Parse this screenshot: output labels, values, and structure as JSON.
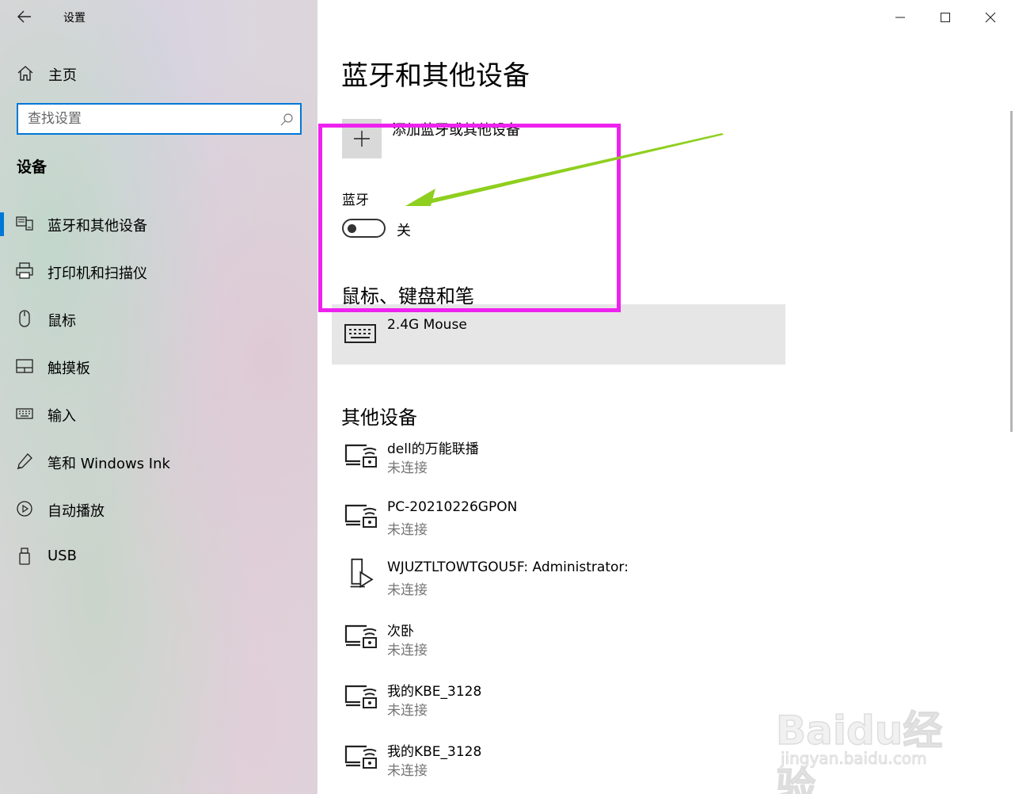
{
  "window": {
    "title": "设置",
    "controls": {
      "minimize": "minimize-icon",
      "maximize": "maximize-icon",
      "close": "close-icon"
    }
  },
  "sidebar": {
    "home_label": "主页",
    "search_placeholder": "查找设置",
    "section_title": "设备",
    "items": [
      {
        "label": "蓝牙和其他设备",
        "icon": "bluetooth-devices-icon",
        "selected": true
      },
      {
        "label": "打印机和扫描仪",
        "icon": "printer-icon"
      },
      {
        "label": "鼠标",
        "icon": "mouse-icon"
      },
      {
        "label": "触摸板",
        "icon": "touchpad-icon"
      },
      {
        "label": "输入",
        "icon": "keyboard-icon"
      },
      {
        "label": "笔和 Windows Ink",
        "icon": "pen-icon"
      },
      {
        "label": "自动播放",
        "icon": "autoplay-icon"
      },
      {
        "label": "USB",
        "icon": "usb-icon"
      }
    ]
  },
  "main": {
    "page_title": "蓝牙和其他设备",
    "add_device_label": "添加蓝牙或其他设备",
    "bluetooth_label": "蓝牙",
    "bluetooth_state": "关",
    "bluetooth_on": false,
    "mouse_section_title": "鼠标、键盘和笔",
    "mouse_devices": [
      {
        "name": "2.4G Mouse",
        "icon": "keyboard-icon"
      }
    ],
    "other_section_title": "其他设备",
    "other_devices": [
      {
        "name": "dell的万能联播",
        "status": "未连接",
        "icon": "media-device-icon"
      },
      {
        "name": "PC-20210226GPON",
        "status": "未连接",
        "icon": "media-device-icon"
      },
      {
        "name": "WJUZTLTOWTGOU5F: Administrator:",
        "status": "未连接",
        "icon": "media-player-icon"
      },
      {
        "name": "次卧",
        "status": "未连接",
        "icon": "media-device-icon"
      },
      {
        "name": "我的KBE_3128",
        "status": "未连接",
        "icon": "media-device-icon"
      },
      {
        "name": "我的KBE_3128",
        "status": "未连接",
        "icon": "media-device-icon"
      }
    ]
  },
  "annotation": {
    "highlight_color": "#ee22ee",
    "arrow_color": "#8fcf1f"
  },
  "watermark": {
    "line1": "Baidu经验",
    "line2": "jingyan.baidu.com"
  },
  "colors": {
    "accent": "#0078d7",
    "card_bg": "#e6e6e6",
    "status_gray": "#767676"
  }
}
